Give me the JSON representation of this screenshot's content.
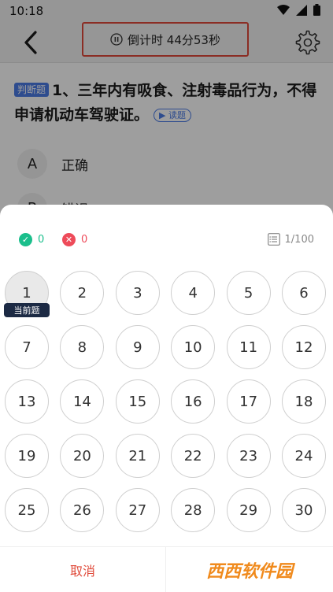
{
  "status_bar": {
    "time": "10:18"
  },
  "header": {
    "timer_text": "倒计时 44分53秒"
  },
  "question": {
    "type_tag": "判断题",
    "text": "1、三年内有吸食、注射毒品行为，不得申请机动车驾驶证。",
    "read_label": "读题",
    "options": [
      {
        "letter": "A",
        "text": "正确"
      },
      {
        "letter": "B",
        "text": "错误"
      }
    ]
  },
  "sheet": {
    "correct_count": "0",
    "wrong_count": "0",
    "progress": "1/100",
    "current_label": "当前题",
    "numbers": [
      "1",
      "2",
      "3",
      "4",
      "5",
      "6",
      "7",
      "8",
      "9",
      "10",
      "11",
      "12",
      "13",
      "14",
      "15",
      "16",
      "17",
      "18",
      "19",
      "20",
      "21",
      "22",
      "23",
      "24",
      "25",
      "26",
      "27",
      "28",
      "29",
      "30"
    ],
    "cancel_label": "取消",
    "watermark": "西西软件园"
  },
  "colors": {
    "accent": "#4b7be6",
    "correct": "#1bbf8c",
    "wrong": "#ee4b5a",
    "cancel": "#e04a3a"
  }
}
